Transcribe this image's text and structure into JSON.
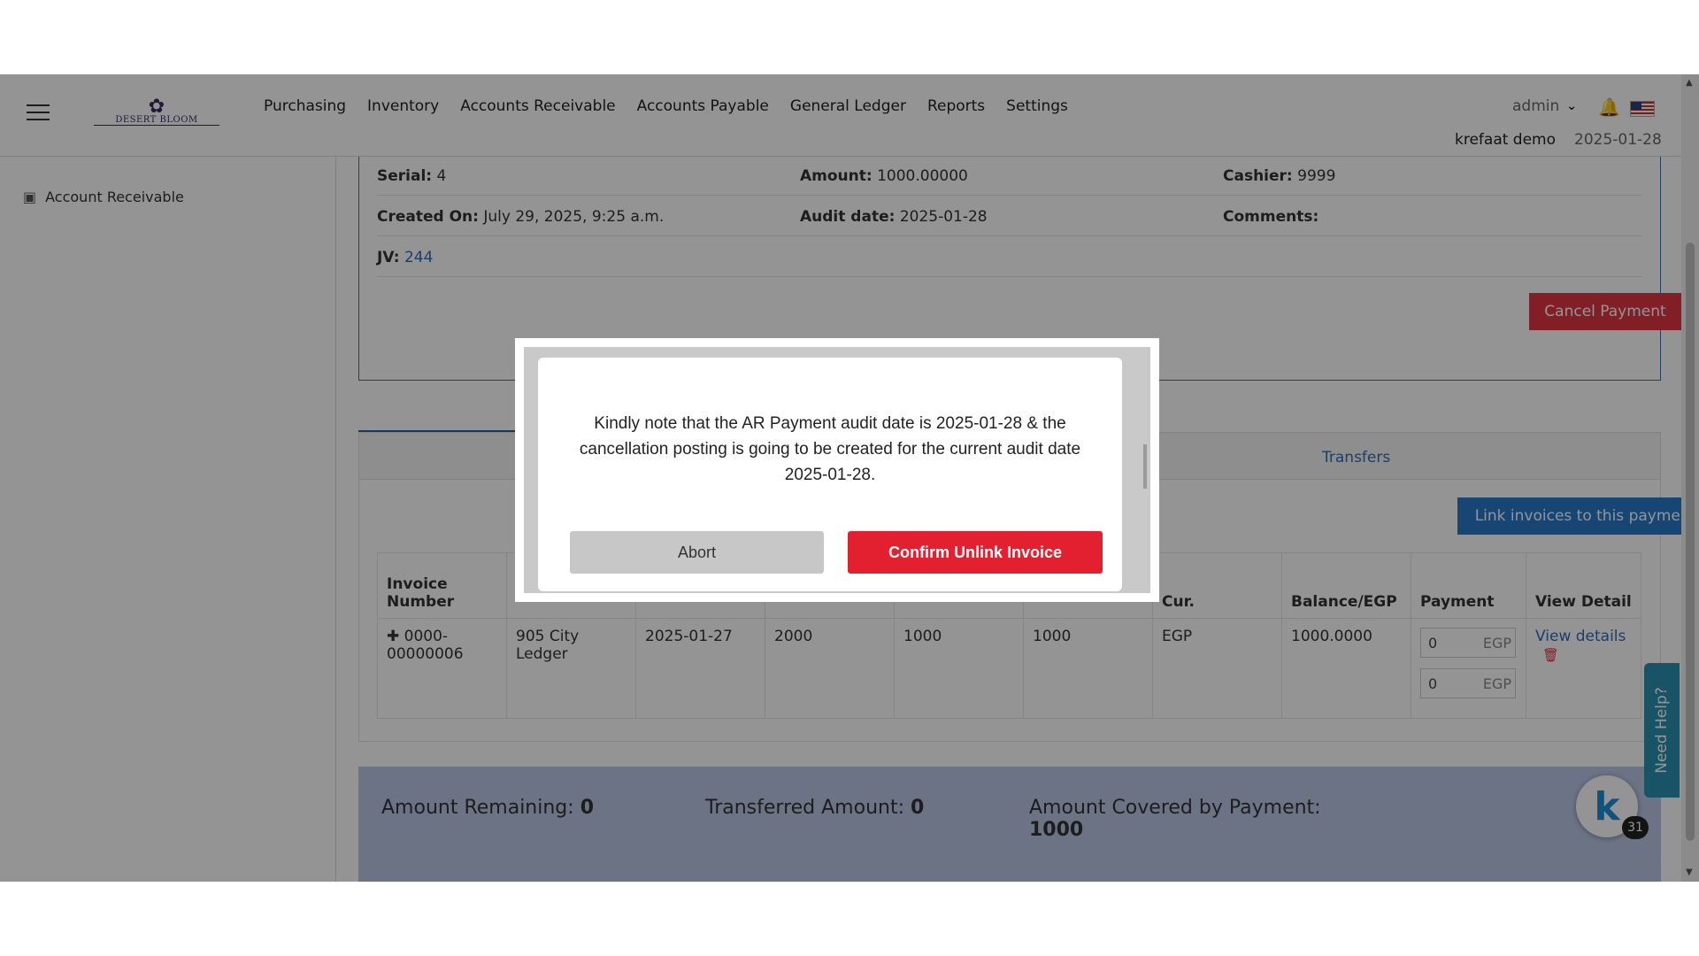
{
  "header": {
    "logo_text": "DESERT BLOOM",
    "nav": [
      "Purchasing",
      "Inventory",
      "Accounts Receivable",
      "Accounts Payable",
      "General Ledger",
      "Reports",
      "Settings"
    ],
    "user": "admin",
    "company": "krefaat demo",
    "date": "2025-01-28"
  },
  "sidebar": {
    "items": [
      {
        "label": "Account Receivable"
      }
    ]
  },
  "info": {
    "serial_label": "Serial:",
    "serial": "4",
    "amount_label": "Amount:",
    "amount": "1000.00000",
    "cashier_label": "Cashier:",
    "cashier": "9999",
    "created_label": "Created On:",
    "created": "July 29, 2025, 9:25 a.m.",
    "audit_label": "Audit date:",
    "audit": "2025-01-28",
    "comments_label": "Comments:",
    "jv_label": "JV:",
    "jv": "244",
    "cancel_button": "Cancel Payment"
  },
  "tabs": {
    "transfers": "Transfers"
  },
  "invoices": {
    "link_button": "Link invoices to this payment",
    "columns": [
      "Invoice Number",
      "",
      "",
      "",
      "",
      "",
      "Cur.",
      "Balance/EGP",
      "Payment",
      "View Detail"
    ],
    "row": {
      "invoice_number": "0000-00000006",
      "col2": "905 City Ledger",
      "col3": "2025-01-27",
      "col4": "2000",
      "col5": "1000",
      "col6": "1000",
      "currency": "EGP",
      "balance": "1000.0000",
      "payment_1": "0",
      "payment_2": "0",
      "payment_currency": "EGP",
      "view_details": "View details"
    }
  },
  "summary": {
    "remaining_label": "Amount Remaining:",
    "remaining": "0",
    "transferred_label": "Transferred Amount:",
    "transferred": "0",
    "covered_label": "Amount Covered by Payment:",
    "covered": "1000"
  },
  "help": {
    "label": "Need Help?",
    "chat_badge": "31",
    "chat_letter": "k"
  },
  "modal": {
    "message": "Kindly note that the AR Payment audit date is 2025-01-28 & the cancellation posting is going to be created for the current audit date 2025-01-28.",
    "abort": "Abort",
    "confirm": "Confirm Unlink Invoice"
  },
  "colors": {
    "accent_blue": "#2a79c9",
    "danger_red": "#e32030",
    "summary_bg": "#b8c6e6"
  }
}
